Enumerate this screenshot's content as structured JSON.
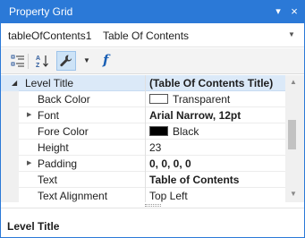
{
  "window": {
    "title": "Property Grid",
    "pin_glyph": "▾",
    "close_glyph": "×",
    "accent_color": "#2b79d7"
  },
  "selector": {
    "object_name": "tableOfContents1",
    "object_type": "Table Of Contents",
    "dropdown_glyph": "▼"
  },
  "toolbar": {
    "icons": [
      "categorized-icon",
      "alphabetical-icon",
      "wrench-icon",
      "dropdown-arrow-icon",
      "function-icon"
    ],
    "function_glyph": "f",
    "dropdown_glyph": "▼"
  },
  "grid": {
    "category": {
      "label": "Level Title",
      "value": "(Table Of Contents Title)",
      "expanded": true
    },
    "rows": [
      {
        "label": "Back Color",
        "value": "Transparent",
        "swatch": "#ffffff",
        "bold": false,
        "expandable": false
      },
      {
        "label": "Font",
        "value": "Arial Narrow, 12pt",
        "bold": true,
        "expandable": true
      },
      {
        "label": "Fore Color",
        "value": "Black",
        "swatch": "#000000",
        "bold": false,
        "expandable": false
      },
      {
        "label": "Height",
        "value": "23",
        "bold": false,
        "expandable": false
      },
      {
        "label": "Padding",
        "value": "0, 0, 0, 0",
        "bold": true,
        "expandable": true
      },
      {
        "label": "Text",
        "value": "Table of Contents",
        "bold": true,
        "expandable": false
      },
      {
        "label": "Text Alignment",
        "value": "Top Left",
        "bold": false,
        "expandable": false
      }
    ],
    "expand_glyph": "▶",
    "collapse_glyph": "◢"
  },
  "scrollbar": {
    "up_glyph": "▲",
    "down_glyph": "▼"
  },
  "description": {
    "title": "Level Title"
  }
}
